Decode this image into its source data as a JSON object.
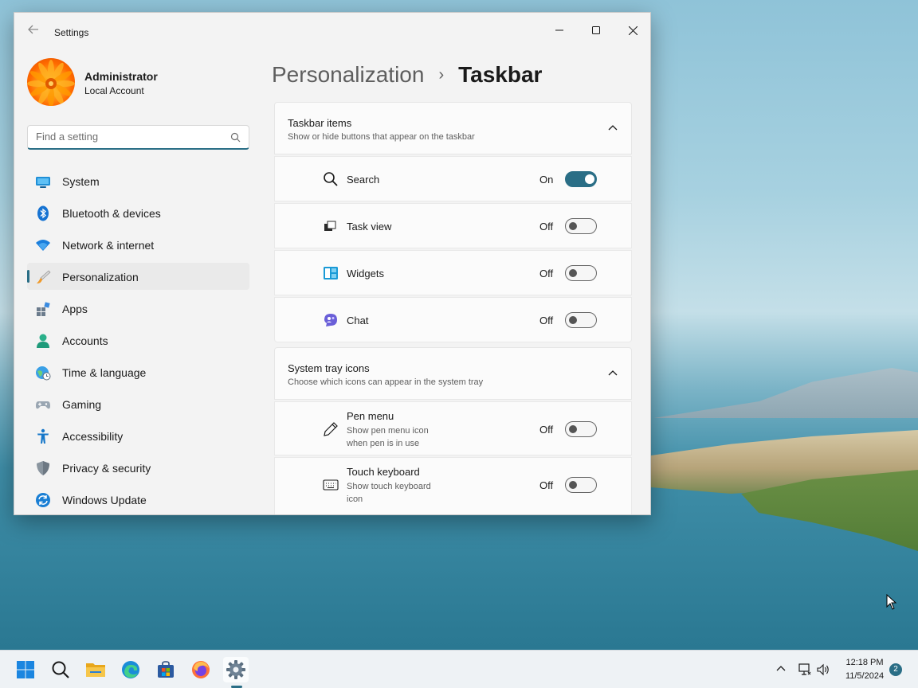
{
  "window": {
    "title": "Settings",
    "back_icon": "back-arrow-icon",
    "controls": [
      "minimize-icon",
      "maximize-icon",
      "close-icon"
    ]
  },
  "profile": {
    "name": "Administrator",
    "account_type": "Local Account"
  },
  "search": {
    "placeholder": "Find a setting",
    "icon": "search-icon"
  },
  "nav": {
    "items": [
      {
        "label": "System",
        "icon": "system-icon"
      },
      {
        "label": "Bluetooth & devices",
        "icon": "bluetooth-icon"
      },
      {
        "label": "Network & internet",
        "icon": "wifi-icon"
      },
      {
        "label": "Personalization",
        "icon": "brush-icon",
        "active": true
      },
      {
        "label": "Apps",
        "icon": "apps-icon"
      },
      {
        "label": "Accounts",
        "icon": "accounts-icon"
      },
      {
        "label": "Time & language",
        "icon": "globe-clock-icon"
      },
      {
        "label": "Gaming",
        "icon": "gamepad-icon"
      },
      {
        "label": "Accessibility",
        "icon": "accessibility-icon"
      },
      {
        "label": "Privacy & security",
        "icon": "shield-icon"
      },
      {
        "label": "Windows Update",
        "icon": "update-icon"
      }
    ],
    "accent": "#2a6e86"
  },
  "breadcrumb": {
    "parent": "Personalization",
    "separator": "›",
    "current": "Taskbar"
  },
  "taskbar_items": {
    "title": "Taskbar items",
    "subtitle": "Show or hide buttons that appear on the taskbar",
    "rows": [
      {
        "label": "Search",
        "state": "On",
        "on": true,
        "icon": "search-icon"
      },
      {
        "label": "Task view",
        "state": "Off",
        "on": false,
        "icon": "task-view-icon"
      },
      {
        "label": "Widgets",
        "state": "Off",
        "on": false,
        "icon": "widgets-icon"
      },
      {
        "label": "Chat",
        "state": "Off",
        "on": false,
        "icon": "chat-icon"
      }
    ]
  },
  "tray_icons": {
    "title": "System tray icons",
    "subtitle": "Choose which icons can appear in the system tray",
    "rows": [
      {
        "label": "Pen menu",
        "desc_line1": "Show pen menu icon",
        "desc_line2": "when pen is in use",
        "state": "Off",
        "on": false,
        "icon": "pen-icon"
      },
      {
        "label": "Touch keyboard",
        "desc_line1": "Show touch keyboard",
        "desc_line2": "icon",
        "state": "Off",
        "on": false,
        "icon": "keyboard-icon"
      }
    ]
  },
  "taskbar": {
    "apps": [
      "start-icon",
      "search-icon",
      "file-explorer-icon",
      "edge-icon",
      "store-icon",
      "firefox-icon",
      "settings-icon"
    ],
    "clock": {
      "time": "12:18 PM",
      "date": "11/5/2024"
    },
    "notifications": "2",
    "tray": [
      "chevron-up-icon",
      "network-icon",
      "volume-icon"
    ]
  }
}
